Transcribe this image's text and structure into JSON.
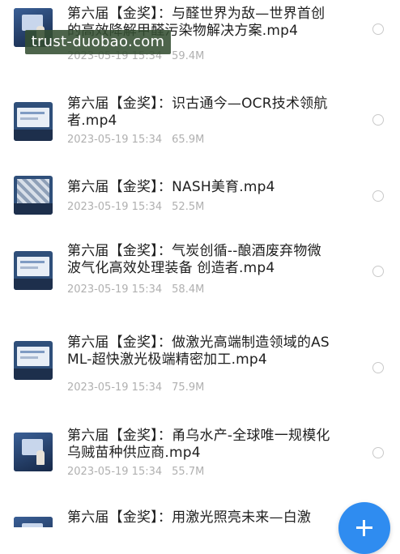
{
  "watermark": "trust-duobao.com",
  "files": [
    {
      "title": "第六届【金奖】：与醛世界为敌—世界首创的高效降解甲醛污染物解决方案.mp4",
      "date": "2023-05-19 15:34",
      "size": "59.4M",
      "thumb_icon": "video-thumbnail"
    },
    {
      "title": "第六届【金奖】：识古通今—OCR技术领航者.mp4",
      "date": "2023-05-19 15:34",
      "size": "65.9M",
      "thumb_icon": "video-thumbnail"
    },
    {
      "title": "第六届【金奖】：NASH美育.mp4",
      "date": "2023-05-19 15:34",
      "size": "52.5M",
      "thumb_icon": "video-thumbnail"
    },
    {
      "title": "第六届【金奖】：气炭创循--酿酒废弃物微波气化高效处理装备 创造者.mp4",
      "date": "2023-05-19 15:34",
      "size": "58.4M",
      "thumb_icon": "video-thumbnail"
    },
    {
      "title": "第六届【金奖】：做激光高端制造领域的ASML-超快激光极端精密加工.mp4",
      "date": "2023-05-19 15:34",
      "size": "75.9M",
      "thumb_icon": "video-thumbnail"
    },
    {
      "title": "第六届【金奖】：甬乌水产-全球唯一规模化乌贼苗种供应商.mp4",
      "date": "2023-05-19 15:34",
      "size": "55.7M",
      "thumb_icon": "video-thumbnail"
    },
    {
      "title": "第六届【金奖】：用激光照亮未来—白激",
      "date": "",
      "size": "",
      "thumb_icon": "video-thumbnail"
    }
  ],
  "fab_icon": "plus-icon",
  "colors": {
    "accent": "#2f8cf0",
    "meta_text": "#b0b0b0",
    "title_text": "#1f1f1f",
    "watermark_bg": "#344e32"
  }
}
